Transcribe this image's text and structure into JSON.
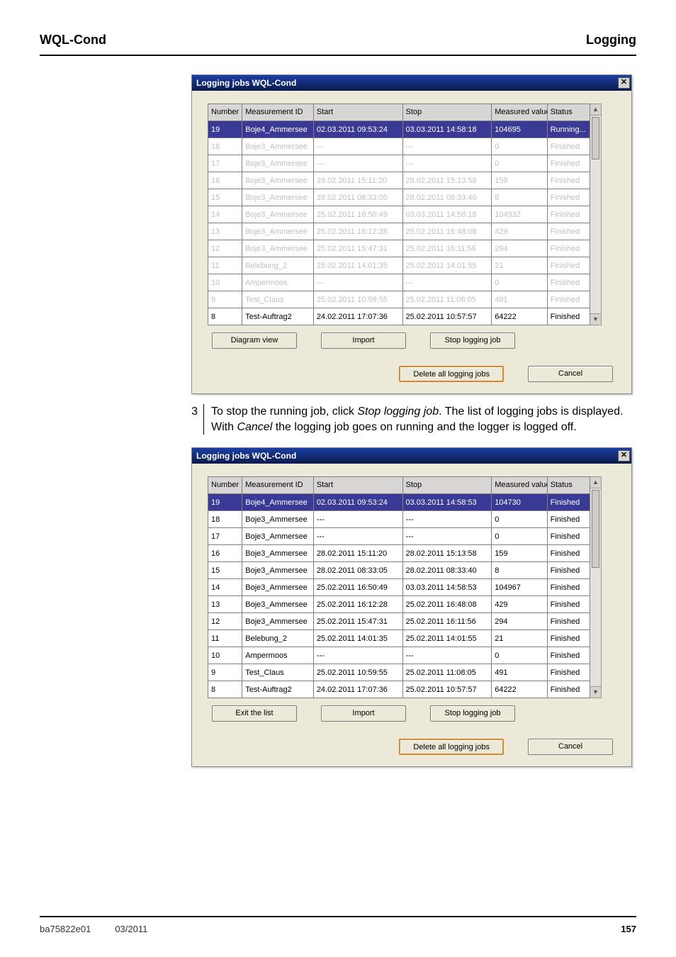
{
  "page_header": {
    "left": "WQL-Cond",
    "right": "Logging"
  },
  "step": {
    "num": "3",
    "line1a": "To stop the running job, click ",
    "line1b": "Stop logging job",
    "line1c": ". The list of logging jobs is displayed.",
    "line2a": "With ",
    "line2b": "Cancel",
    "line2c": " the logging job goes on running and the logger is logged off."
  },
  "window_title": "Logging jobs WQL-Cond",
  "columns": {
    "number": "Number",
    "meas_id": "Measurement ID",
    "start": "Start",
    "stop": "Stop",
    "meas_val": "Measured values",
    "status": "Status"
  },
  "tableA": {
    "btn_left": "Diagram view",
    "btn_mid": "Import",
    "btn_right": "Stop logging job",
    "btn_delete": "Delete all logging jobs",
    "btn_cancel": "Cancel",
    "rows": [
      {
        "n": "19",
        "m": "Boje4_Ammersee",
        "s": "02.03.2011 09:53:24",
        "e": "03.03.2011 14:58:18",
        "v": "104695",
        "st": "Running..."
      },
      {
        "n": "18",
        "m": "Boje3_Ammersee",
        "s": "---",
        "e": "---",
        "v": "0",
        "st": "Finished"
      },
      {
        "n": "17",
        "m": "Boje3_Ammersee",
        "s": "---",
        "e": "---",
        "v": "0",
        "st": "Finished"
      },
      {
        "n": "16",
        "m": "Boje3_Ammersee",
        "s": "28.02.2011 15:11:20",
        "e": "28.02.2011 15:13:58",
        "v": "159",
        "st": "Finished"
      },
      {
        "n": "15",
        "m": "Boje3_Ammersee",
        "s": "28.02.2011 08:33:05",
        "e": "28.02.2011 08:33:40",
        "v": "8",
        "st": "Finished"
      },
      {
        "n": "14",
        "m": "Boje3_Ammersee",
        "s": "25.02.2011 16:50:49",
        "e": "03.03.2011 14:58:18",
        "v": "104932",
        "st": "Finished"
      },
      {
        "n": "13",
        "m": "Boje3_Ammersee",
        "s": "25.02.2011 16:12:28",
        "e": "25.02.2011 16:48:08",
        "v": "429",
        "st": "Finished"
      },
      {
        "n": "12",
        "m": "Boje3_Ammersee",
        "s": "25.02.2011 15:47:31",
        "e": "25.02.2011 16:11:56",
        "v": "294",
        "st": "Finished"
      },
      {
        "n": "11",
        "m": "Belebung_2",
        "s": "25.02.2011 14:01:35",
        "e": "25.02.2011 14:01:55",
        "v": "21",
        "st": "Finished"
      },
      {
        "n": "10",
        "m": "Ampermoos",
        "s": "---",
        "e": "---",
        "v": "0",
        "st": "Finished"
      },
      {
        "n": "9",
        "m": "Test_Claus",
        "s": "25.02.2011 10:59:55",
        "e": "25.02.2011 11:08:05",
        "v": "491",
        "st": "Finished"
      },
      {
        "n": "8",
        "m": "Test-Auftrag2",
        "s": "24.02.2011 17:07:36",
        "e": "25.02.2011 10:57:57",
        "v": "64222",
        "st": "Finished"
      }
    ]
  },
  "tableB": {
    "btn_left": "Exit the list",
    "btn_mid": "Import",
    "btn_right": "Stop logging job",
    "btn_delete": "Delete all logging jobs",
    "btn_cancel": "Cancel",
    "rows": [
      {
        "n": "19",
        "m": "Boje4_Ammersee",
        "s": "02.03.2011 09:53:24",
        "e": "03.03.2011 14:58:53",
        "v": "104730",
        "st": "Finished"
      },
      {
        "n": "18",
        "m": "Boje3_Ammersee",
        "s": "---",
        "e": "---",
        "v": "0",
        "st": "Finished"
      },
      {
        "n": "17",
        "m": "Boje3_Ammersee",
        "s": "---",
        "e": "---",
        "v": "0",
        "st": "Finished"
      },
      {
        "n": "16",
        "m": "Boje3_Ammersee",
        "s": "28.02.2011 15:11:20",
        "e": "28.02.2011 15:13:58",
        "v": "159",
        "st": "Finished"
      },
      {
        "n": "15",
        "m": "Boje3_Ammersee",
        "s": "28.02.2011 08:33:05",
        "e": "28.02.2011 08:33:40",
        "v": "8",
        "st": "Finished"
      },
      {
        "n": "14",
        "m": "Boje3_Ammersee",
        "s": "25.02.2011 16:50:49",
        "e": "03.03.2011 14:58:53",
        "v": "104967",
        "st": "Finished"
      },
      {
        "n": "13",
        "m": "Boje3_Ammersee",
        "s": "25.02.2011 16:12:28",
        "e": "25.02.2011 16:48:08",
        "v": "429",
        "st": "Finished"
      },
      {
        "n": "12",
        "m": "Boje3_Ammersee",
        "s": "25.02.2011 15:47:31",
        "e": "25.02.2011 16:11:56",
        "v": "294",
        "st": "Finished"
      },
      {
        "n": "11",
        "m": "Belebung_2",
        "s": "25.02.2011 14:01:35",
        "e": "25.02.2011 14:01:55",
        "v": "21",
        "st": "Finished"
      },
      {
        "n": "10",
        "m": "Ampermoos",
        "s": "---",
        "e": "---",
        "v": "0",
        "st": "Finished"
      },
      {
        "n": "9",
        "m": "Test_Claus",
        "s": "25.02.2011 10:59:55",
        "e": "25.02.2011 11:08:05",
        "v": "491",
        "st": "Finished"
      },
      {
        "n": "8",
        "m": "Test-Auftrag2",
        "s": "24.02.2011 17:07:36",
        "e": "25.02.2011 10:57:57",
        "v": "64222",
        "st": "Finished"
      }
    ]
  },
  "footer": {
    "doc": "ba75822e01",
    "date": "03/2011",
    "page": "157"
  }
}
